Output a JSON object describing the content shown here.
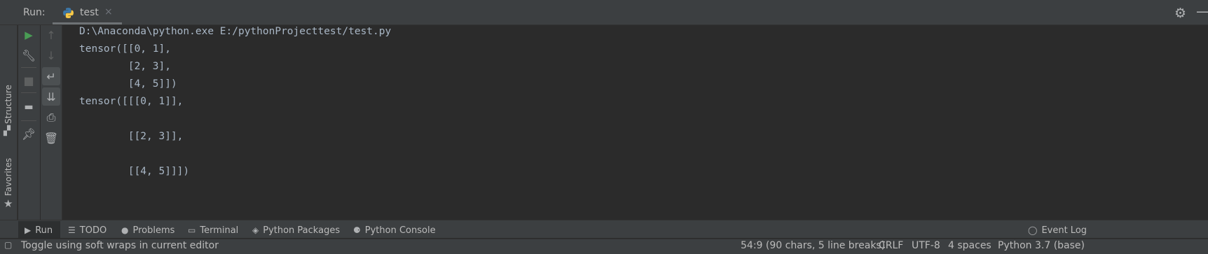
{
  "titlebar": {
    "run_label": "Run:",
    "tab_label": "test",
    "tab_close": "×",
    "gear_icon": "gear-icon",
    "minimize_icon": "minimize-icon"
  },
  "left_stripe": {
    "structure_label": "Structure",
    "favorites_label": "Favorites"
  },
  "console": {
    "lines": [
      "D:\\Anaconda\\python.exe E:/pythonProjecttest/test.py",
      "tensor([[0, 1],",
      "        [2, 3],",
      "        [4, 5]])",
      "tensor([[[0, 1]],",
      "",
      "        [[2, 3]],",
      "",
      "        [[4, 5]]])"
    ]
  },
  "bottom_tabs": [
    {
      "label": "Run",
      "icon": "play-icon"
    },
    {
      "label": "TODO",
      "icon": "list-icon"
    },
    {
      "label": "Problems",
      "icon": "info-icon"
    },
    {
      "label": "Terminal",
      "icon": "terminal-icon"
    },
    {
      "label": "Python Packages",
      "icon": "layers-icon"
    },
    {
      "label": "Python Console",
      "icon": "python-icon"
    }
  ],
  "event_log_label": "Event Log",
  "status": {
    "message": "Toggle using soft wraps in current editor",
    "position": "54:9 (90 chars, 5 line breaks)",
    "line_sep": "CRLF",
    "encoding": "UTF-8",
    "indent": "4 spaces",
    "interpreter": "Python 3.7 (base)"
  },
  "colors": {
    "run_green": "#499c54",
    "console_text": "#a9b7c6",
    "panel_bg": "#3c3f41",
    "editor_bg": "#2b2b2b"
  }
}
